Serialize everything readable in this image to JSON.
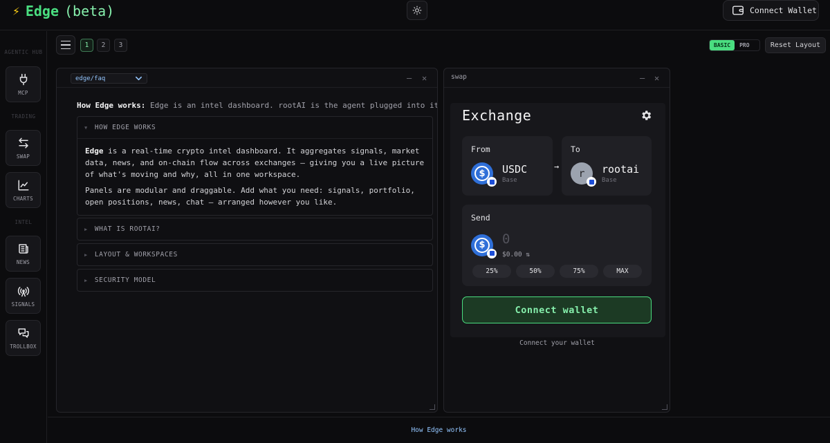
{
  "app": {
    "bolt": "⚡",
    "name": "Edge",
    "tag": "(beta)",
    "connect_wallet_label": "Connect Wallet"
  },
  "sidebar": {
    "sections": [
      "AGENTIC HUB",
      "TRADING",
      "INTEL"
    ],
    "items": [
      {
        "label": "MCP",
        "icon": "plug-icon"
      },
      {
        "label": "SWAP",
        "icon": "swap-arrows-icon"
      },
      {
        "label": "CHARTS",
        "icon": "line-chart-icon"
      },
      {
        "label": "NEWS",
        "icon": "newspaper-icon"
      },
      {
        "label": "SIGNALS",
        "icon": "antenna-icon"
      },
      {
        "label": "TROLLBOX",
        "icon": "chat-bubbles-icon"
      }
    ]
  },
  "toolbar": {
    "workspaces": [
      "1",
      "2",
      "3"
    ],
    "active_workspace": "1",
    "mode_basic": "BASIC",
    "mode_pro": "PRO",
    "active_mode": "BASIC",
    "reset_label": "Reset Layout"
  },
  "faq_panel": {
    "selected_route": "edge/faq",
    "intro_bold": "How Edge works:",
    "intro_text": "Edge is an intel dashboard. rootAI is the agent plugged into it.",
    "sections": [
      {
        "title": "HOW EDGE WORKS",
        "expanded": true,
        "body_bold": "Edge",
        "body_p1": "is a real-time crypto intel dashboard. It aggregates signals, market data, news, and on-chain flow across exchanges — giving you a live picture of what's moving and why, all in one workspace.",
        "body_p2": "Panels are modular and draggable. Add what you need: signals, portfolio, open positions, news, chat — arranged however you like."
      },
      {
        "title": "WHAT IS ROOTAI?",
        "expanded": false
      },
      {
        "title": "LAYOUT & WORKSPACES",
        "expanded": false
      },
      {
        "title": "SECURITY MODEL",
        "expanded": false
      }
    ]
  },
  "swap_panel": {
    "title": "swap",
    "heading": "Exchange",
    "from_label": "From",
    "to_label": "To",
    "from_token": {
      "symbol": "USDC",
      "chain": "Base"
    },
    "to_token": {
      "symbol": "rootai",
      "chain": "Base",
      "avatar_letter": "r"
    },
    "send_label": "Send",
    "amount": "0",
    "usd_value": "$0.00",
    "percent_buttons": [
      "25%",
      "50%",
      "75%",
      "MAX"
    ],
    "connect_label": "Connect wallet",
    "hint": "Connect your wallet"
  },
  "footer": {
    "text": "How Edge works"
  },
  "colors": {
    "accent": "#4ade80",
    "link": "#93c5fd",
    "usdc": "#2f6fd8"
  }
}
